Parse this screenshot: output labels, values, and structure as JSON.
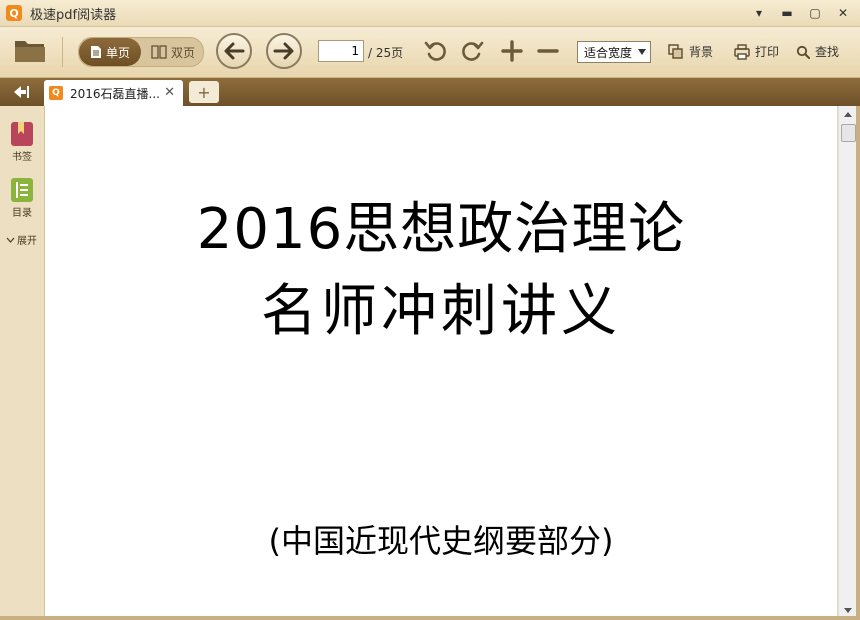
{
  "app": {
    "title": "极速pdf阅读器",
    "logo_glyph": "Q"
  },
  "window_controls": [
    {
      "name": "menu-dropdown",
      "glyph": "▾"
    },
    {
      "name": "minimize",
      "glyph": "▬"
    },
    {
      "name": "maximize",
      "glyph": "▢"
    },
    {
      "name": "close",
      "glyph": "✕"
    }
  ],
  "toolbar": {
    "single_page_label": "单页",
    "double_page_label": "双页",
    "current_page": "1",
    "total_pages": "/ 25页",
    "zoom_mode": "适合宽度",
    "background_label": "背景",
    "print_label": "打印",
    "find_label": "查找"
  },
  "tabs": [
    {
      "label": "2016石磊直播...",
      "active": true
    }
  ],
  "sidebar": {
    "bookmark_label": "书签",
    "outline_label": "目录",
    "expand_label": "展开"
  },
  "document": {
    "title_line1": "2016思想政治理论",
    "title_line2": "名师冲刺讲义",
    "subtitle": "(中国近现代史纲要部分)"
  },
  "colors": {
    "accent_orange": "#f08a1c",
    "toolbar_bg": "#efe1c0",
    "tabbar_bg": "#7e5e32",
    "bookmark_red": "#b8455a",
    "outline_green": "#8cb43c"
  }
}
